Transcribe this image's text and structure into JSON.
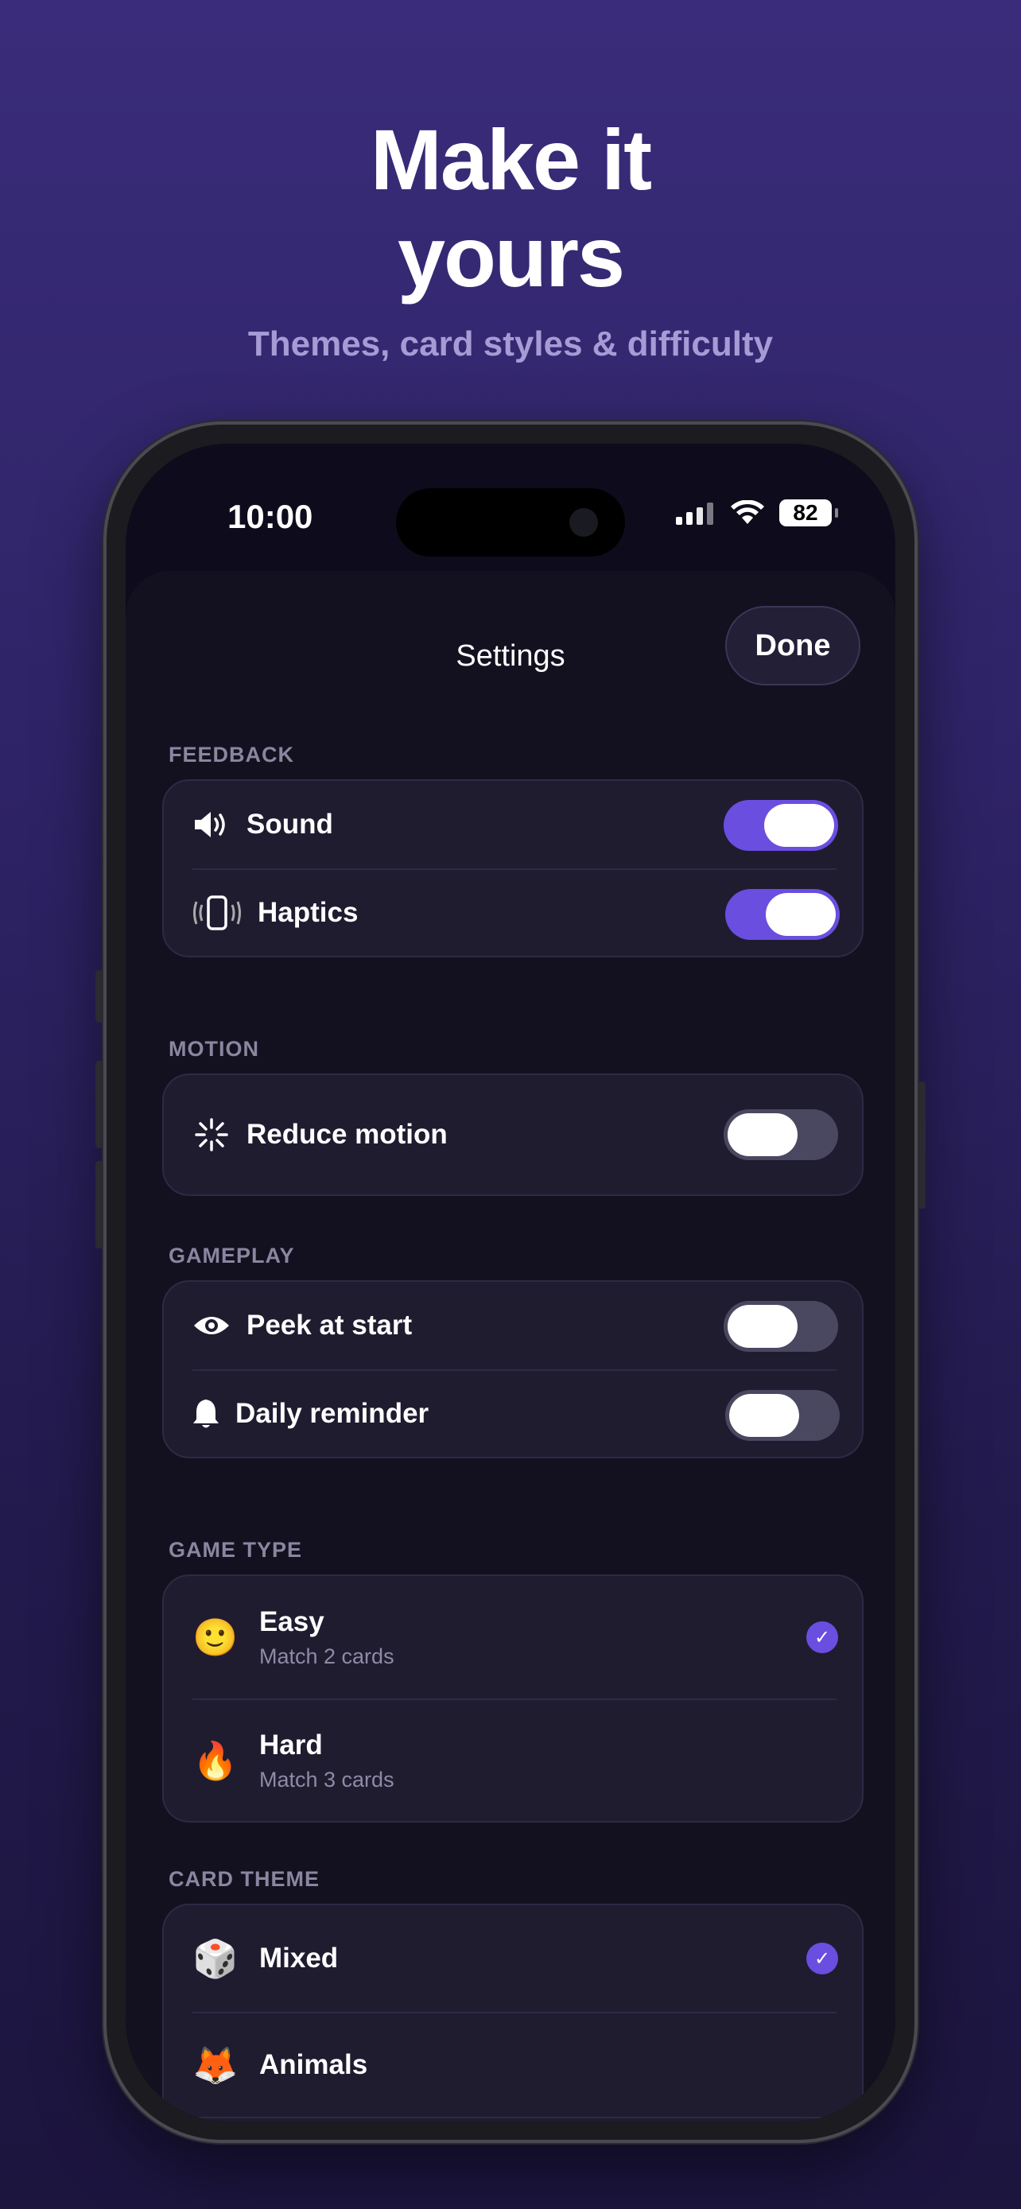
{
  "hero": {
    "title_line1": "Make it",
    "title_line2": "yours",
    "subtitle": "Themes, card styles & difficulty"
  },
  "status": {
    "time": "10:00",
    "battery": "82"
  },
  "sheet": {
    "title": "Settings",
    "done": "Done"
  },
  "sections": {
    "feedback": {
      "label": "FEEDBACK",
      "rows": [
        {
          "label": "Sound",
          "icon": "speaker-icon",
          "on": true
        },
        {
          "label": "Haptics",
          "icon": "vibration-icon",
          "on": true
        }
      ]
    },
    "motion": {
      "label": "MOTION",
      "rows": [
        {
          "label": "Reduce motion",
          "icon": "sparkle-icon",
          "on": false
        }
      ]
    },
    "gameplay": {
      "label": "GAMEPLAY",
      "rows": [
        {
          "label": "Peek at start",
          "icon": "eye-icon",
          "on": false
        },
        {
          "label": "Daily reminder",
          "icon": "bell-icon",
          "on": false
        }
      ]
    },
    "game_type": {
      "label": "GAME TYPE",
      "options": [
        {
          "title": "Easy",
          "subtitle": "Match 2 cards",
          "emoji": "🙂",
          "selected": true
        },
        {
          "title": "Hard",
          "subtitle": "Match 3 cards",
          "emoji": "🔥",
          "selected": false
        }
      ]
    },
    "card_theme": {
      "label": "CARD THEME",
      "options": [
        {
          "title": "Mixed",
          "emoji": "🎲",
          "selected": true
        },
        {
          "title": "Animals",
          "emoji": "🦊",
          "selected": false
        }
      ]
    }
  },
  "colors": {
    "accent": "#6a4ee0",
    "background": "#2e2366",
    "card": "#1f1c30"
  }
}
